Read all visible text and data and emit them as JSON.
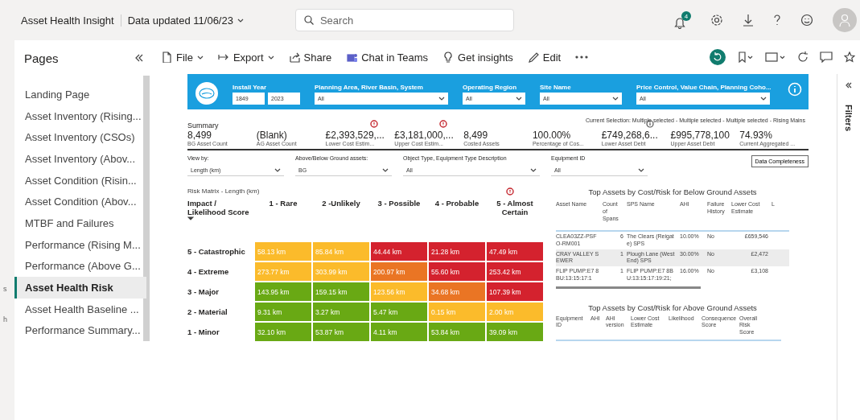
{
  "app": {
    "title": "Asset Health Insight",
    "data_updated": "Data updated 11/06/23",
    "search_placeholder": "Search",
    "notification_count": "4"
  },
  "toolbar": [
    {
      "label": "File",
      "kind": "file",
      "menu": true
    },
    {
      "label": "Export",
      "kind": "export",
      "menu": true
    },
    {
      "label": "Share",
      "kind": "share",
      "menu": false
    },
    {
      "label": "Chat in Teams",
      "kind": "teams",
      "menu": false
    },
    {
      "label": "Get insights",
      "kind": "insights",
      "menu": false
    },
    {
      "label": "Edit",
      "kind": "edit",
      "menu": false
    }
  ],
  "edge_fragments": [
    "s",
    "h"
  ],
  "pages": {
    "title": "Pages",
    "items": [
      {
        "label": "Landing Page",
        "selected": false
      },
      {
        "label": "Asset Inventory (Rising...",
        "selected": false
      },
      {
        "label": "Asset Inventory (CSOs)",
        "selected": false
      },
      {
        "label": "Asset Inventory (Abov...",
        "selected": false
      },
      {
        "label": "Asset Condition (Risin...",
        "selected": false
      },
      {
        "label": "Asset Condition (Abov...",
        "selected": false
      },
      {
        "label": "MTBF and Failures",
        "selected": false
      },
      {
        "label": "Performance (Rising M...",
        "selected": false
      },
      {
        "label": "Performance (Above G...",
        "selected": false
      },
      {
        "label": "Asset Health Risk",
        "selected": true
      },
      {
        "label": "Asset Health Baseline ...",
        "selected": false
      },
      {
        "label": "Performance Summary...",
        "selected": false
      }
    ]
  },
  "filter_banner": {
    "install_year": {
      "label": "Install Year",
      "from": "1849",
      "to": "2023"
    },
    "dropdowns": [
      {
        "label": "Planning Area, River Basin, System",
        "value": "All"
      },
      {
        "label": "Operating Region",
        "value": "All"
      },
      {
        "label": "Site Name",
        "value": "All"
      },
      {
        "label": "Price Control, Value Chain, Planning Coho...",
        "value": "All"
      }
    ]
  },
  "current_selection": "Current Selection:  Multiple selected -  Multiple selected -  Multiple selected - Rising Mains",
  "summary": {
    "title": "Summary",
    "kpis": [
      {
        "value": "8,499",
        "label": "BG Asset Count",
        "kind": "plain"
      },
      {
        "value": "(Blank)",
        "label": "AG Asset Count",
        "kind": "plain"
      },
      {
        "value": "£2,393,529,...",
        "label": "Lower Cost Estim...",
        "kind": "warning"
      },
      {
        "value": "£3,181,000,...",
        "label": "Upper Cost Estim...",
        "kind": "warning"
      },
      {
        "value": "8,499",
        "label": "Costed Assets",
        "kind": "plain"
      },
      {
        "value": "100.00%",
        "label": "Percentage of Cos...",
        "kind": "plain"
      },
      {
        "value": "£749,268,6...",
        "label": "Lower Asset Debt",
        "kind": "info"
      },
      {
        "value": "£995,778,100",
        "label": "Upper Asset Debt",
        "kind": "plain"
      },
      {
        "value": "74.93%",
        "label": "Current Aggregated ...",
        "kind": "plain"
      }
    ]
  },
  "slicers": [
    {
      "label": "View by:",
      "value": "Length (km)"
    },
    {
      "label": "Above/Below Ground assets:",
      "value": "BG"
    },
    {
      "label": "Object Type, Equipment Type Description",
      "value": "All"
    },
    {
      "label": "Equipment ID",
      "value": "All"
    }
  ],
  "data_completeness_button": "Data Completeness",
  "risk_matrix": {
    "title": "Risk Matrix - Length (km)",
    "corner": "Impact / Likelihood Score",
    "columns": [
      "1 - Rare",
      "2 -Unlikely",
      "3 - Possible",
      "4 - Probable",
      "5 - Almost Certain"
    ],
    "rows": [
      {
        "label": "5 - Catastrophic",
        "cells": [
          {
            "value": "58.13 km",
            "color": "#fbbb2b"
          },
          {
            "value": "85.84 km",
            "color": "#fbbb2b"
          },
          {
            "value": "44.44 km",
            "color": "#d4222e"
          },
          {
            "value": "21.28 km",
            "color": "#d4222e"
          },
          {
            "value": "47.49 km",
            "color": "#d4222e"
          }
        ]
      },
      {
        "label": "4 - Extreme",
        "cells": [
          {
            "value": "273.77 km",
            "color": "#fbbb2b"
          },
          {
            "value": "303.99 km",
            "color": "#fbbb2b"
          },
          {
            "value": "200.97 km",
            "color": "#ea7524"
          },
          {
            "value": "55.60 km",
            "color": "#d4222e"
          },
          {
            "value": "253.42 km",
            "color": "#d4222e"
          }
        ]
      },
      {
        "label": "3 - Major",
        "cells": [
          {
            "value": "143.95 km",
            "color": "#69a914"
          },
          {
            "value": "159.15 km",
            "color": "#69a914"
          },
          {
            "value": "123.56 km",
            "color": "#fbbb2b"
          },
          {
            "value": "34.68 km",
            "color": "#ea7524"
          },
          {
            "value": "107.39 km",
            "color": "#d4222e"
          }
        ]
      },
      {
        "label": "2 - Material",
        "cells": [
          {
            "value": "9.31 km",
            "color": "#69a914"
          },
          {
            "value": "3.27 km",
            "color": "#69a914"
          },
          {
            "value": "5.47 km",
            "color": "#69a914"
          },
          {
            "value": "0.15 km",
            "color": "#fbbb2b"
          },
          {
            "value": "2.00 km",
            "color": "#fbbb2b"
          }
        ]
      },
      {
        "label": "1 - Minor",
        "cells": [
          {
            "value": "32.10 km",
            "color": "#69a914"
          },
          {
            "value": "53.87 km",
            "color": "#69a914"
          },
          {
            "value": "4.11 km",
            "color": "#69a914"
          },
          {
            "value": "53.84 km",
            "color": "#69a914"
          },
          {
            "value": "39.09 km",
            "color": "#69a914"
          }
        ]
      }
    ]
  },
  "below_ground_table": {
    "title": "Top Assets by Cost/Risk for Below Ground Assets",
    "columns": [
      "Asset Name",
      "Count of Spans",
      "SPS Name",
      "AHI",
      "Failure History",
      "Lower Cost Estimate",
      "L"
    ],
    "rows": [
      {
        "cells": [
          "CLEA03ZZ-PSFO-RM001",
          "6",
          "The Clears (Reigate) SPS",
          "10.00%",
          "No",
          "£659,546"
        ],
        "selected": false
      },
      {
        "cells": [
          "CRAY VALLEY SEWER",
          "1",
          "Plough Lane (West End) SPS",
          "30.00%",
          "No",
          "£2,472"
        ],
        "selected": true
      },
      {
        "cells": [
          "FLIP PUMP:E7 8BU:13:15:17:1",
          "1",
          "FLIP PUMP:E7 8BU:13:15:17:19:21;",
          "16.00%",
          "No",
          "£3,108"
        ],
        "selected": false
      }
    ]
  },
  "above_ground_table": {
    "title": "Top Assets by Cost/Risk for Above Ground Assets",
    "columns": [
      "Equipment ID",
      "AHI",
      "AHI version",
      "Lower Cost Estimate",
      "Likelihood",
      "Consequence Score",
      "Overall Risk Score"
    ]
  },
  "filters_pane": {
    "title": "Filters"
  }
}
